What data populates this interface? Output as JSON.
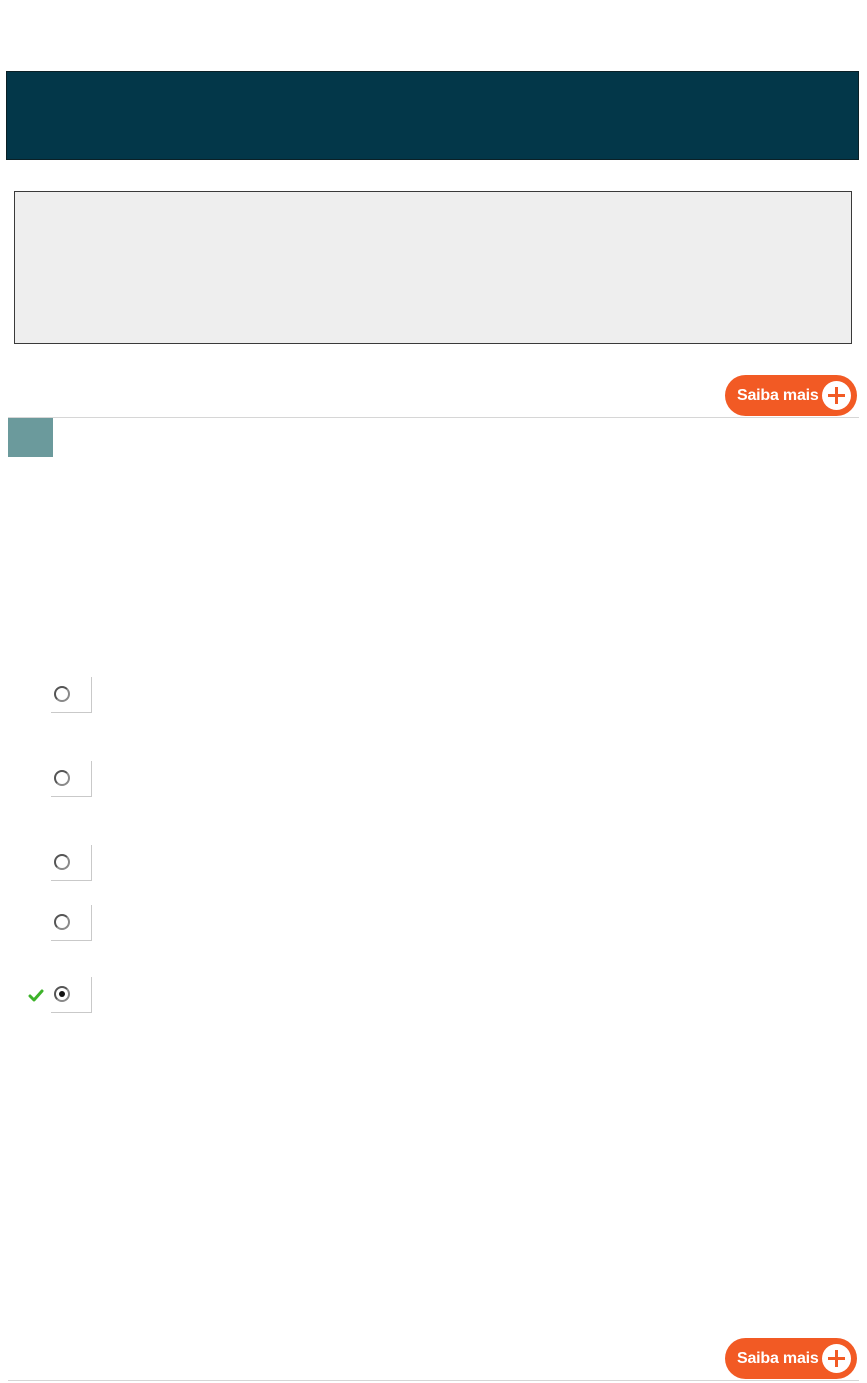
{
  "buttons": {
    "saiba_mais_label": "Saiba mais"
  },
  "quiz": {
    "options": [
      {
        "selected": false,
        "correct": false
      },
      {
        "selected": false,
        "correct": false
      },
      {
        "selected": false,
        "correct": false
      },
      {
        "selected": false,
        "correct": false
      },
      {
        "selected": true,
        "correct": true
      }
    ]
  },
  "colors": {
    "header": "#033749",
    "panel": "#eeeeee",
    "accent": "#f25a24",
    "badge": "#6b9a9c",
    "check": "#3db22a"
  },
  "icons": {
    "plus": "plus-circle-icon",
    "check": "checkmark-icon",
    "radio": "radio-icon"
  }
}
